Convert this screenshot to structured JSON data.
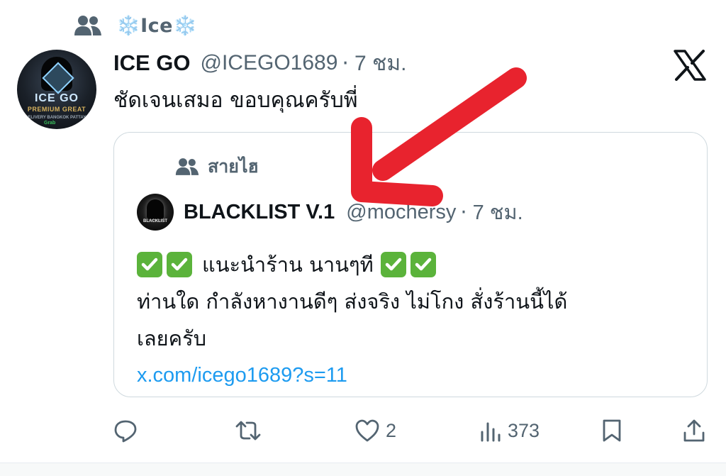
{
  "social_context": {
    "icon": "people-icon",
    "name": "❄️Ice❄️"
  },
  "tweet": {
    "avatar_text": {
      "main": "ICE GO",
      "sub": "PREMIUM GREAT",
      "tag": "DELIVERY BANGKOK PATTAYA",
      "badge": "Grab"
    },
    "display_name": "ICE GO",
    "handle": "@ICEGO1689",
    "separator": "·",
    "timestamp": "7 ชม.",
    "text": "ชัดเจนเสมอ ขอบคุณครับพี่",
    "platform_icon": "x-logo-icon"
  },
  "quote": {
    "context_icon": "people-icon",
    "context_name": "สายไฮ",
    "avatar_text": "BLACKLIST",
    "display_name": "BLACKLIST V.1",
    "handle": "@mochersy",
    "separator": "·",
    "timestamp": "7 ชม.",
    "line1_text": "แนะนำร้าน นานๆที",
    "line2": "ท่านใด กำลังหางานดีๆ ส่งจริง ไม่โกง สั่งร้านนี้ได้",
    "line3": "เลยครับ",
    "link": "x.com/icego1689?s=11",
    "emoji": "check-mark-button-emoji"
  },
  "annotation": {
    "type": "red-arrow",
    "color": "#e8232e"
  },
  "actions": {
    "reply": {
      "icon": "reply-icon",
      "count": ""
    },
    "retweet": {
      "icon": "retweet-icon",
      "count": ""
    },
    "like": {
      "icon": "heart-icon",
      "count": "2"
    },
    "views": {
      "icon": "views-icon",
      "count": "373"
    },
    "bookmark": {
      "icon": "bookmark-icon",
      "count": ""
    },
    "share": {
      "icon": "share-icon",
      "count": ""
    }
  },
  "colors": {
    "text": "#0f1419",
    "secondary": "#536471",
    "link": "#1d9bf0",
    "border": "#cfd9de",
    "check_green": "#5bb33b"
  }
}
